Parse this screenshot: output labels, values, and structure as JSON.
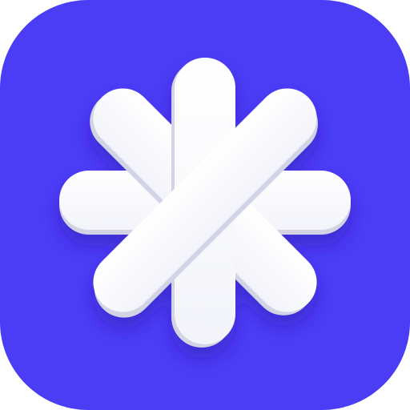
{
  "icon": {
    "name": "asterisk-app-icon",
    "background_color": "#4B3CF6",
    "bar_color": "#FFFFFF",
    "bar_shadow_color": "#C9CCDF",
    "glyph": "asterisk"
  }
}
